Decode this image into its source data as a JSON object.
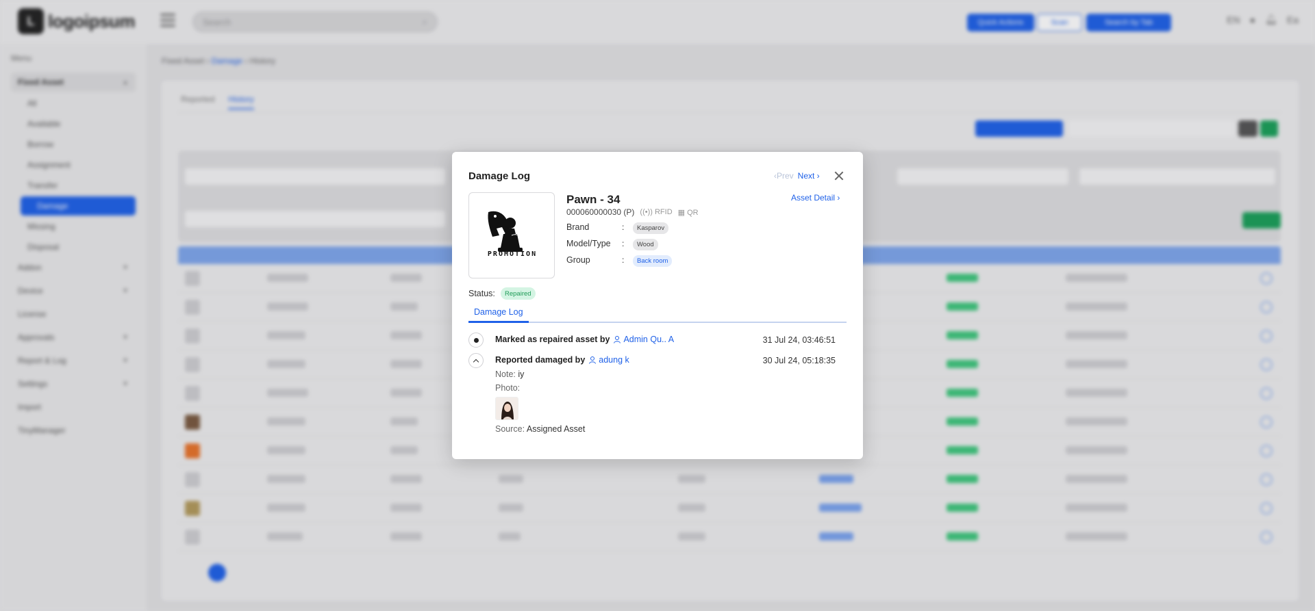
{
  "app": {
    "logo_text": "logoipsum",
    "search_placeholder": "Search",
    "top_buttons": [
      "Quick Actions",
      "Scan",
      "Search by Tab"
    ],
    "lang": "EN",
    "user_initials": "Ea"
  },
  "sidebar": {
    "caption": "Menu",
    "group": "Fixed Asset",
    "items": [
      "All",
      "Available",
      "Borrow",
      "Assignment",
      "Transfer",
      "Damage",
      "Missing",
      "Disposal"
    ],
    "others": [
      "Addon",
      "Device",
      "License",
      "Approvals",
      "Report & Log",
      "Settings",
      "Import",
      "TinyManager"
    ]
  },
  "breadcrumb": {
    "root": "Fixed Asset",
    "section": "Damage",
    "current": "History"
  },
  "page_tabs": [
    "Reported",
    "History"
  ],
  "modal": {
    "title": "Damage Log",
    "prev_label": "‹Prev",
    "next_label": "Next ›",
    "asset": {
      "name": "Pawn - 34",
      "code": "000060000030 (P)",
      "rfid_label": "((•)) RFID",
      "qr_label": "QR",
      "detail_link": "Asset Detail ›",
      "image_caption": "PROMOTION",
      "props": [
        {
          "label": "Brand",
          "value": "Kasparov",
          "style": "grey"
        },
        {
          "label": "Model/Type",
          "value": "Wood",
          "style": "grey"
        },
        {
          "label": "Group",
          "value": "Back room",
          "style": "blue"
        }
      ]
    },
    "status_label": "Status:",
    "status_value": "Repaired",
    "tab_label": "Damage Log",
    "events": [
      {
        "action": "Marked as repaired asset by",
        "user": "Admin Qu.. A",
        "time": "31 Jul 24, 03:46:51"
      },
      {
        "action": "Reported damaged by",
        "user": "adung k",
        "time": "30 Jul 24, 05:18:35",
        "note_label": "Note:",
        "note": "iy",
        "photo_label": "Photo:",
        "source_label": "Source:",
        "source": "Assigned Asset"
      }
    ]
  },
  "colors": {
    "accent": "#1f61e8",
    "status_green_bg": "#d4f4e3",
    "status_green_text": "#1e9b57"
  }
}
